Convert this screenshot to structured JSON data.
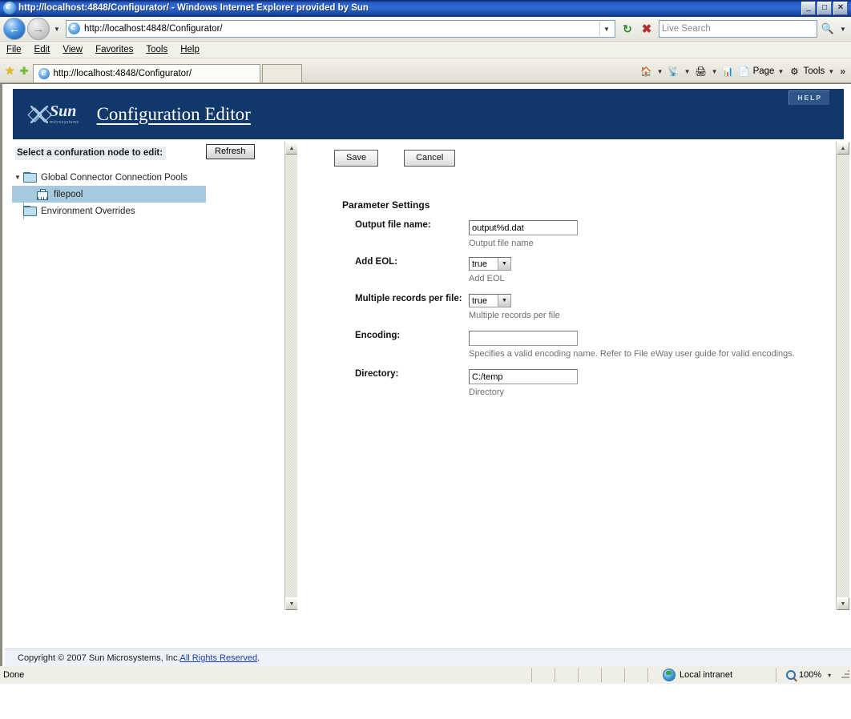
{
  "window": {
    "title": "http://localhost:4848/Configurator/ - Windows Internet Explorer provided by Sun",
    "minimize_label": "_",
    "maximize_label": "□",
    "close_label": "✕"
  },
  "address_bar": {
    "url": "http://localhost:4848/Configurator/",
    "dropdown_icon": "chevron-down-icon",
    "refresh_icon": "refresh-icon",
    "stop_icon": "stop-icon",
    "search_placeholder": "Live Search",
    "search_go_icon": "magnifier-icon",
    "back_icon": "back-arrow-icon",
    "forward_icon": "forward-arrow-icon"
  },
  "menu": {
    "items": [
      {
        "label": "File",
        "accel": "F"
      },
      {
        "label": "Edit",
        "accel": "E"
      },
      {
        "label": "View",
        "accel": "V"
      },
      {
        "label": "Favorites",
        "accel": "a"
      },
      {
        "label": "Tools",
        "accel": "T"
      },
      {
        "label": "Help",
        "accel": "H"
      }
    ]
  },
  "tabs_bar": {
    "favorites_icon": "star-icon",
    "add_favorite_icon": "star-plus-icon",
    "tabs": [
      {
        "label": "http://localhost:4848/Configurator/",
        "icon": "ie-favicon",
        "active": true
      },
      {
        "label": "",
        "icon": "",
        "active": false
      }
    ],
    "toolbar": [
      {
        "name": "home-button",
        "label": "",
        "icon": "home-icon",
        "has_caret": true
      },
      {
        "name": "feeds-button",
        "label": "",
        "icon": "rss-icon",
        "has_caret": true
      },
      {
        "name": "print-button",
        "label": "",
        "icon": "printer-icon",
        "has_caret": true
      },
      {
        "name": "research-button",
        "label": "",
        "icon": "research-icon",
        "has_caret": false
      },
      {
        "name": "page-menu-button",
        "label": "Page",
        "icon": "page-icon",
        "has_caret": true
      },
      {
        "name": "tools-menu-button",
        "label": "Tools",
        "icon": "gear-icon",
        "has_caret": true
      }
    ],
    "overflow_label": "»"
  },
  "banner": {
    "logo_word": "Sun",
    "logo_sub": "microsystems",
    "title": "Configuration Editor",
    "help_label": "HELP"
  },
  "tree_pane": {
    "header": "Select a confuration node to edit:",
    "refresh_button": "Refresh",
    "nodes": [
      {
        "label": "Global Connector Connection Pools",
        "type": "folder",
        "expanded": true,
        "selected": false
      },
      {
        "label": "filepool",
        "type": "node",
        "expanded": false,
        "selected": true
      },
      {
        "label": "Environment Overrides",
        "type": "folder",
        "expanded": false,
        "selected": false
      }
    ]
  },
  "content": {
    "save_label": "Save",
    "cancel_label": "Cancel",
    "section_title": "Parameter Settings",
    "fields": [
      {
        "label": "Output file name:",
        "type": "text",
        "value": "output%d.dat",
        "hint": "Output file name"
      },
      {
        "label": "Add EOL:",
        "type": "select",
        "value": "true",
        "options": [
          "true",
          "false"
        ],
        "hint": "Add EOL"
      },
      {
        "label": "Multiple records per file:",
        "type": "select",
        "value": "true",
        "options": [
          "true",
          "false"
        ],
        "hint": "Multiple records per file"
      },
      {
        "label": "Encoding:",
        "type": "text",
        "value": "",
        "hint": "Specifies a valid encoding name. Refer to File eWay user guide for valid encodings."
      },
      {
        "label": "Directory:",
        "type": "text",
        "value": "C:/temp",
        "hint": "Directory"
      }
    ]
  },
  "page_footer": {
    "copyright": "Copyright © 2007 Sun Microsystems, Inc. ",
    "link": "All Rights Reserved",
    "period": "."
  },
  "status_bar": {
    "status": "Done",
    "zone": "Local intranet",
    "zone_icon": "globe-icon",
    "zoom": "100%",
    "zoom_icon": "magnifier-icon",
    "zoom_caret": "▾"
  },
  "colors": {
    "banner_blue": "#10386a",
    "selection_blue": "#a8cade",
    "title_gradient_start": "#0a246a",
    "link_blue": "#1b3fb0"
  }
}
